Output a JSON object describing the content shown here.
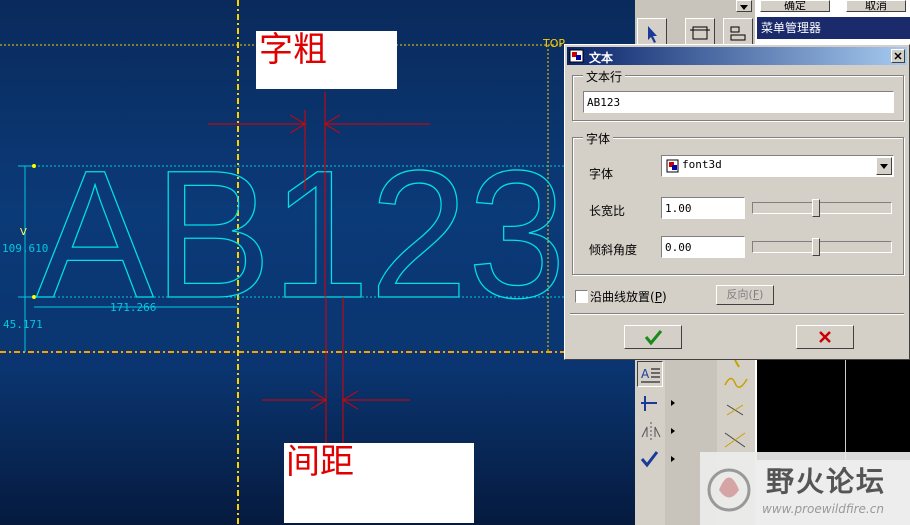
{
  "canvas": {
    "view_label": "TOP",
    "text_preview": "AB123",
    "dim_height": "109.610",
    "dim_width": "171.266",
    "dim_offset": "45.171",
    "dim_v": "V"
  },
  "annotations": {
    "stroke_weight": "字粗",
    "spacing": "间距"
  },
  "toolbar": {
    "top_button": "确定",
    "cancel_button": "取消",
    "menu_manager": "菜单管理器"
  },
  "dialog": {
    "title": "文本",
    "text_line_group": "文本行",
    "text_value": "AB123",
    "font_group": "字体",
    "font_label": "字体",
    "font_value": "font3d",
    "aspect_label": "长宽比",
    "aspect_value": "1.00",
    "slant_label": "倾斜角度",
    "slant_value": "0.00",
    "curve_checkbox": "沿曲线放置",
    "curve_checkbox_key": "P",
    "reverse_button": "反向",
    "reverse_button_key": "F",
    "ok_icon": "check-icon",
    "cancel_icon": "x-icon",
    "aspect_slider_level": 0.45,
    "slant_slider_level": 0.45
  },
  "watermark": {
    "site_name": "野火论坛",
    "site_url": "www.proewildfire.cn"
  },
  "colors": {
    "text_outline": "#00e0e8",
    "construction_line": "#ffd000",
    "annotation_red": "#e00000"
  }
}
